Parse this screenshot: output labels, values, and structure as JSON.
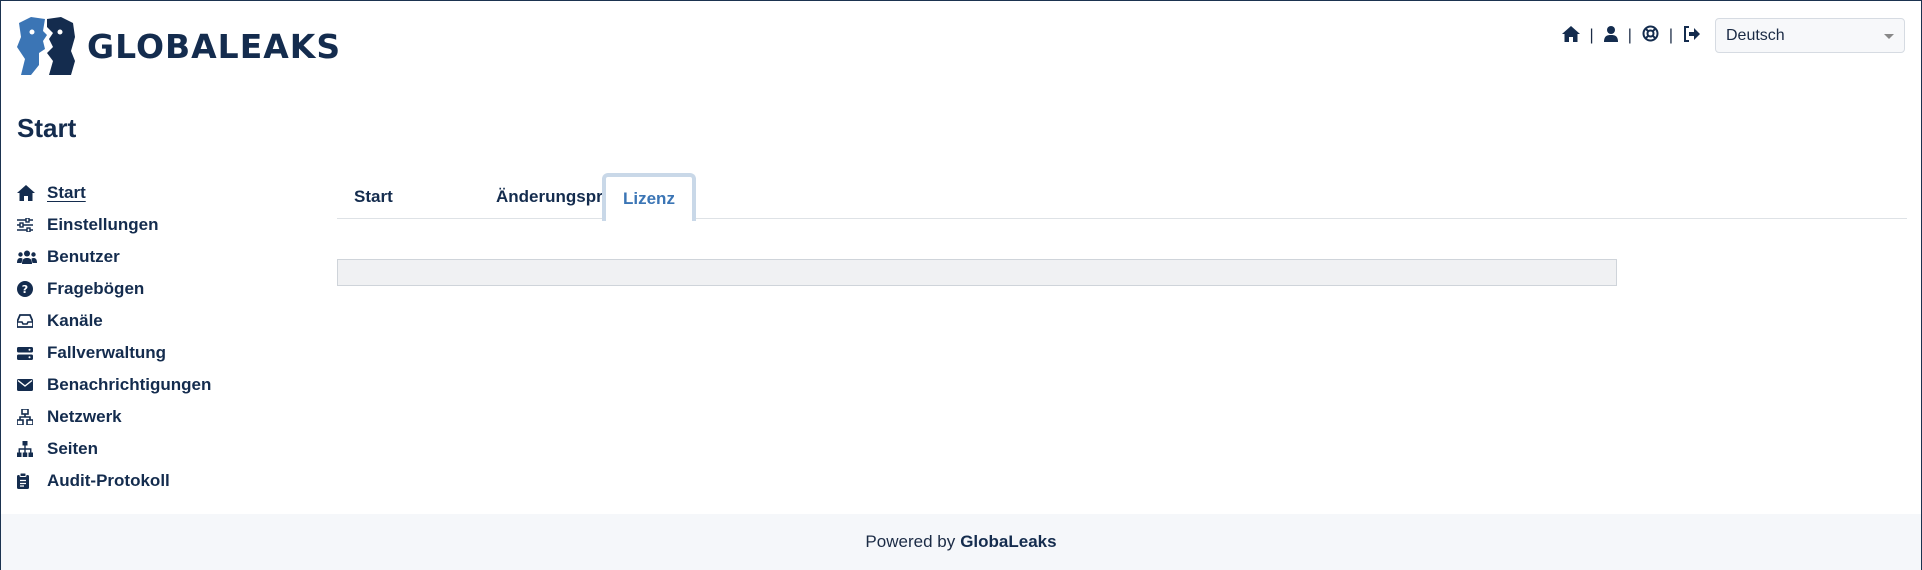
{
  "brand": {
    "name": "GLOBALEAKS",
    "color_primary": "#142c4e",
    "color_accent": "#3b75b5"
  },
  "header": {
    "icons": [
      "home-icon",
      "user-icon",
      "life-ring-icon",
      "sign-out-icon"
    ],
    "separator": "|",
    "language": {
      "selected": "Deutsch"
    }
  },
  "page": {
    "title": "Start"
  },
  "sidebar": {
    "items": [
      {
        "label": "Start",
        "icon": "home-icon",
        "active": true
      },
      {
        "label": "Einstellungen",
        "icon": "sliders-icon"
      },
      {
        "label": "Benutzer",
        "icon": "users-icon"
      },
      {
        "label": "Fragebögen",
        "icon": "question-circle-icon"
      },
      {
        "label": "Kanäle",
        "icon": "inbox-icon"
      },
      {
        "label": "Fallverwaltung",
        "icon": "server-icon"
      },
      {
        "label": "Benachrichtigungen",
        "icon": "envelope-icon"
      },
      {
        "label": "Netzwerk",
        "icon": "network-icon"
      },
      {
        "label": "Seiten",
        "icon": "sitemap-icon"
      },
      {
        "label": "Audit-Protokoll",
        "icon": "clipboard-icon"
      }
    ]
  },
  "tabs": [
    {
      "label": "Start"
    },
    {
      "label": "Änderungsprotokoll"
    },
    {
      "label": "Lizenz",
      "active": true
    }
  ],
  "footer": {
    "prefix": "Powered by",
    "brand": "GlobaLeaks"
  }
}
